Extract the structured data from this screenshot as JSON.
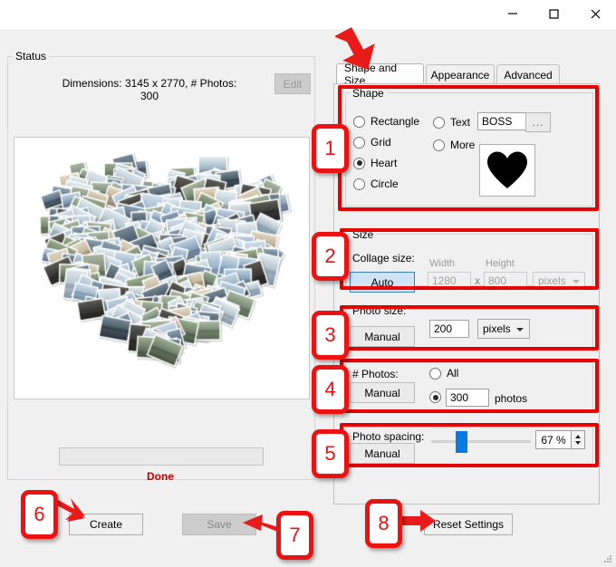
{
  "window": {
    "minimize_icon": "minimize-icon",
    "maximize_icon": "maximize-icon",
    "close_icon": "close-icon"
  },
  "status": {
    "group_label": "Status",
    "dimensions_text": "Dimensions: 3145 x 2770, # Photos: 300",
    "edit_label": "Edit",
    "progress_value": "",
    "done_text": "Done",
    "preview_alt": "heart-shaped-photo-collage"
  },
  "actions": {
    "create_label": "Create",
    "save_label": "Save",
    "reset_label": "Reset Settings"
  },
  "tabs": [
    {
      "label": "Shape and Size",
      "active": true
    },
    {
      "label": "Appearance",
      "active": false
    },
    {
      "label": "Advanced",
      "active": false
    }
  ],
  "shape": {
    "group_label": "Shape",
    "options": [
      {
        "label": "Rectangle",
        "checked": false
      },
      {
        "label": "Grid",
        "checked": false
      },
      {
        "label": "Heart",
        "checked": true
      },
      {
        "label": "Circle",
        "checked": false
      }
    ],
    "text_option_label": "Text",
    "text_value": "BOSS",
    "browse_label": "...",
    "more_option_label": "More",
    "preview_shape": "heart"
  },
  "size": {
    "group_label": "Size",
    "collage_size_label": "Collage size:",
    "mode_button": "Auto",
    "width_caption": "Width",
    "width_value": "1280",
    "separator": "x",
    "height_caption": "Height",
    "height_value": "800",
    "unit_value": "pixels"
  },
  "photo_size": {
    "label": "Photo size:",
    "mode_button": "Manual",
    "value": "200",
    "unit_value": "pixels"
  },
  "num_photos": {
    "label": "# Photos:",
    "mode_button": "Manual",
    "all_label": "All",
    "all_checked": false,
    "count_checked": true,
    "count_value": "300",
    "unit_label": "photos"
  },
  "spacing": {
    "label": "Photo spacing:",
    "mode_button": "Manual",
    "value": "67 %",
    "slider_percent": 30
  },
  "callouts": {
    "b1": "1",
    "b2": "2",
    "b3": "3",
    "b4": "4",
    "b5": "5",
    "b6": "6",
    "b7": "7",
    "b8": "8"
  },
  "colors": {
    "highlight_red": "#e60000",
    "done_red": "#c00000",
    "slider_blue": "#0a7ae0",
    "auto_button_blue": "#cfe3f5"
  }
}
